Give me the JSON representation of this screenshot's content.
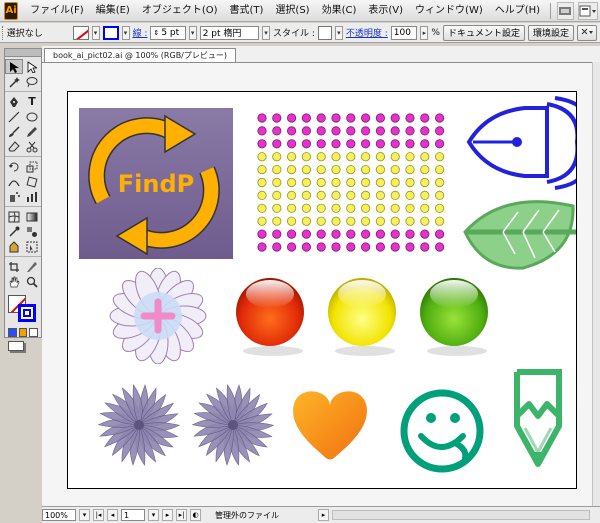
{
  "app": {
    "logo": "Ai"
  },
  "menu": {
    "items": [
      "ファイル(F)",
      "編集(E)",
      "オブジェクト(O)",
      "書式(T)",
      "選択(S)",
      "効果(C)",
      "表示(V)",
      "ウィンドウ(W)",
      "ヘルプ(H)"
    ]
  },
  "control": {
    "selection_label": "選択なし",
    "stroke_label": "線 :",
    "stroke_weight": "5 pt",
    "brush_value": "2 pt 楕円",
    "style_label": "スタイル :",
    "opacity_label": "不透明度 :",
    "opacity_value": "100",
    "opacity_unit": "%",
    "doc_settings_button": "ドキュメント設定",
    "prefs_button": "環境設定"
  },
  "document": {
    "tab_title": "book_ai_pict02.ai @ 100% (RGB/プレビュー)",
    "findp_text": "FindP"
  },
  "status": {
    "zoom": "100%",
    "page": "1",
    "info": "管理外のファイル"
  },
  "colors": {
    "accent_blue": "#1a34c8",
    "arrow_orange": "#ffb000",
    "tile_purple": "#7d6c9b",
    "pen_blue": "#2222dd",
    "leaf_green": "#7cc97b",
    "smile_teal": "#00a07a",
    "pencil_green": "#3cb56a"
  },
  "icons": [
    "selection-tool-icon",
    "direct-selection-icon",
    "magic-wand-icon",
    "lasso-icon",
    "pen-icon",
    "type-icon",
    "line-icon",
    "rectangle-icon",
    "brush-icon",
    "pencil-icon",
    "rotate-icon",
    "scale-icon",
    "warp-icon",
    "free-transform-icon",
    "symbol-sprayer-icon",
    "graph-icon",
    "mesh-icon",
    "gradient-icon",
    "eyedropper-icon",
    "blend-icon",
    "live-paint-icon",
    "live-paint-select-icon",
    "crop-icon",
    "slice-icon",
    "scissors-icon",
    "hand-icon",
    "zoom-icon"
  ]
}
